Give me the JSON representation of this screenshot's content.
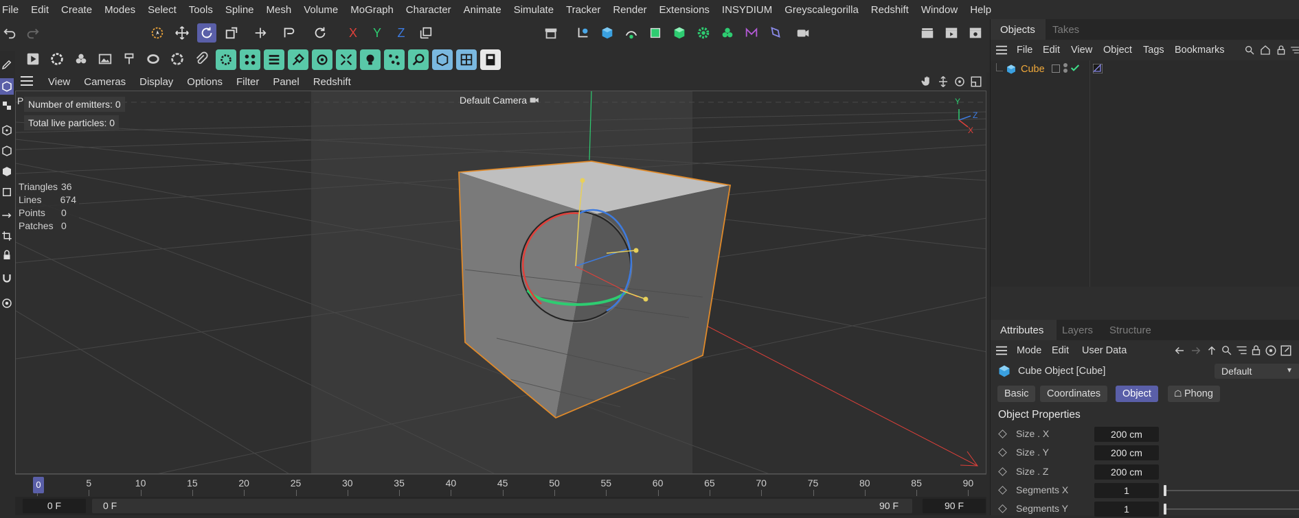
{
  "menubar": {
    "items": [
      "File",
      "Edit",
      "Create",
      "Modes",
      "Select",
      "Tools",
      "Spline",
      "Mesh",
      "Volume",
      "MoGraph",
      "Character",
      "Animate",
      "Simulate",
      "Tracker",
      "Render",
      "Extensions",
      "INSYDIUM",
      "Greyscalegorilla",
      "Redshift",
      "Window",
      "Help"
    ]
  },
  "toolbar": {
    "axis_x": "X",
    "axis_y": "Y",
    "axis_z": "Z"
  },
  "viewport_menu": {
    "items": [
      "View",
      "Cameras",
      "Display",
      "Options",
      "Filter",
      "Panel",
      "Redshift"
    ]
  },
  "viewport": {
    "camera_label": "Default Camera",
    "emitters": "Number of emitters: 0",
    "particles": "Total live particles: 0",
    "corner_letter": "P",
    "stats": [
      {
        "label": "Triangles",
        "value": "36"
      },
      {
        "label": "Lines",
        "value": "674"
      },
      {
        "label": "Points",
        "value": "0"
      },
      {
        "label": "Patches",
        "value": "0"
      }
    ],
    "gizmo": {
      "y": "Y",
      "z": "Z",
      "x": "X"
    },
    "colors": {
      "x_axis": "#e0403a",
      "y_axis": "#2ecc71",
      "z_axis": "#3d7be0",
      "selection": "#e08a2a"
    }
  },
  "timeline": {
    "ticks": [
      "0",
      "5",
      "10",
      "15",
      "20",
      "25",
      "30",
      "35",
      "40",
      "45",
      "50",
      "55",
      "60",
      "65",
      "70",
      "75",
      "80",
      "85",
      "90"
    ],
    "current": "0",
    "start_field": "0 F",
    "range_start": "0 F",
    "range_end": "90 F",
    "end_field": "90 F"
  },
  "objects_panel": {
    "tabs": [
      "Objects",
      "Takes"
    ],
    "menu": [
      "File",
      "Edit",
      "View",
      "Object",
      "Tags",
      "Bookmarks"
    ],
    "object_name": "Cube"
  },
  "attributes_panel": {
    "tabs": [
      "Attributes",
      "Layers",
      "Structure"
    ],
    "menu": [
      "Mode",
      "Edit",
      "User Data"
    ],
    "object_title": "Cube Object [Cube]",
    "preset": "Default",
    "subtabs": [
      "Basic",
      "Coordinates",
      "Object",
      "Phong"
    ],
    "section_title": "Object Properties",
    "properties": [
      {
        "label": "Size . X",
        "value": "200 cm"
      },
      {
        "label": "Size . Y",
        "value": "200 cm"
      },
      {
        "label": "Size . Z",
        "value": "200 cm"
      },
      {
        "label": "Segments X",
        "value": "1"
      },
      {
        "label": "Segments Y",
        "value": "1"
      }
    ]
  }
}
